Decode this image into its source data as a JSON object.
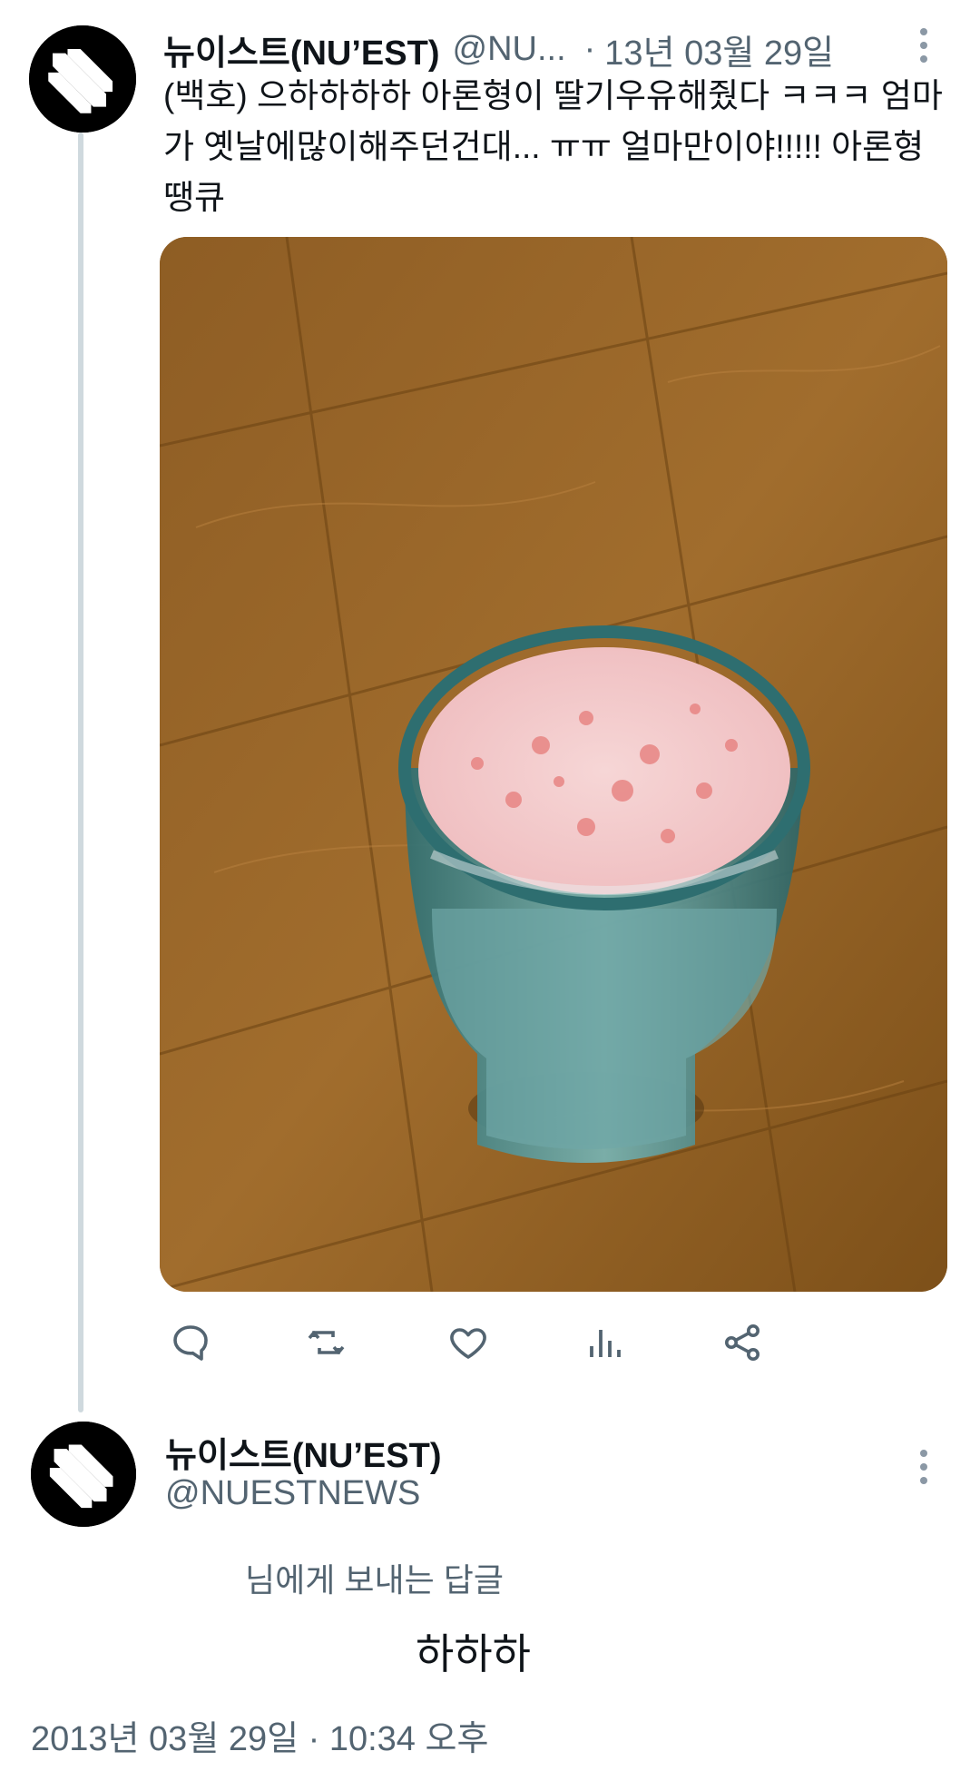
{
  "tweet": {
    "author_name": "뉴이스트(NU’EST)",
    "author_handle": "@NU...",
    "separator": "·",
    "date": "13년 03월 29일",
    "text": "(백호) 으하하하하 아론형이 딸기우유해줬다 ㅋㅋㅋ 엄마\n가 옛날에많이해주던건대... ㅠㅠ 얼마만이야!!!!! 아론형\n땡큐"
  },
  "actions": {
    "reply_icon": "comment-icon",
    "retweet_icon": "retweet-icon",
    "like_icon": "heart-icon",
    "views_icon": "bar-chart-icon",
    "share_icon": "share-icon"
  },
  "reply": {
    "author_name": "뉴이스트(NU’EST)",
    "author_handle": "@NUESTNEWS",
    "replying_to": "님에게 보내는 답글",
    "text": "하하하",
    "timestamp": "2013년 03월 29일 · 10:34 오후"
  },
  "colors": {
    "text_primary": "#0f1419",
    "text_secondary": "#536471",
    "thread_line": "#cfd9de",
    "icon": "#536471"
  }
}
